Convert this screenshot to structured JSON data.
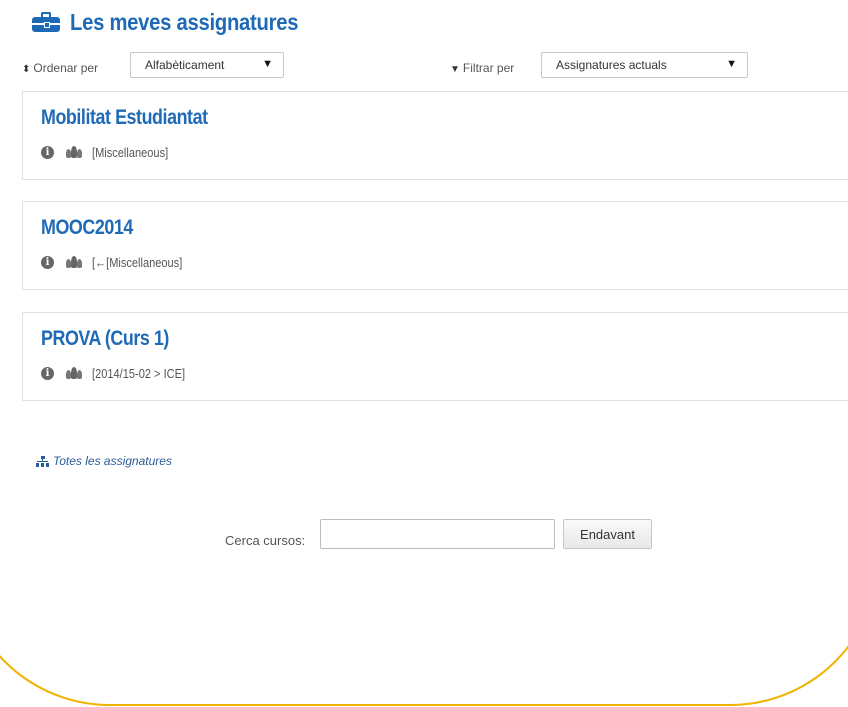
{
  "header": {
    "title": "Les meves assignatures",
    "icon": "briefcase-icon",
    "accent_color": "#1f6ab6"
  },
  "sort": {
    "label": "Ordenar per",
    "icon": "sort-icon",
    "selected": "Alfabèticament"
  },
  "filter": {
    "label": "Filtrar per",
    "icon": "filter-icon",
    "selected": "Assignatures actuals"
  },
  "courses": [
    {
      "title": "Mobilitat Estudiantat",
      "category": "[Miscellaneous]"
    },
    {
      "title": "MOOC2014",
      "category": "[←[Miscellaneous]"
    },
    {
      "title": "PROVA (Curs 1)",
      "category": "[2014/15-02 > ICE]"
    }
  ],
  "all_courses_link": {
    "label": "Totes les assignatures",
    "icon": "sitemap-icon"
  },
  "search": {
    "label": "Cerca cursos:",
    "value": "",
    "button": "Endavant"
  },
  "frame_color": "#f0b400"
}
